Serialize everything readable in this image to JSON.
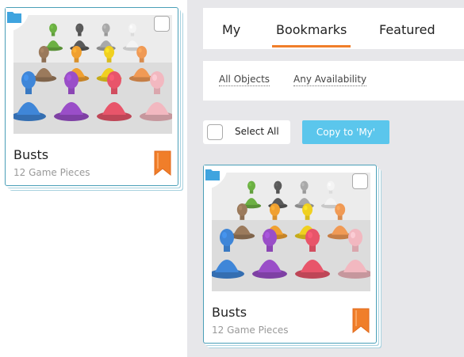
{
  "tabs": [
    {
      "label": "My",
      "active": false
    },
    {
      "label": "Bookmarks",
      "active": true
    },
    {
      "label": "Featured",
      "active": false
    }
  ],
  "filters": {
    "objects": "All Objects",
    "availability": "Any Availability"
  },
  "actions": {
    "select_all": "Select All",
    "copy": "Copy to 'My'"
  },
  "cards": [
    {
      "title": "Busts",
      "subtitle": "12 Game Pieces",
      "image": "busts-thumbnail",
      "bookmarked": true
    },
    {
      "title": "Busts",
      "subtitle": "12 Game Pieces",
      "image": "busts-thumbnail",
      "bookmarked": true
    }
  ],
  "colors": {
    "accent_orange": "#f07e2a",
    "copy_button": "#5bc6ec",
    "folder_blue": "#3fa4df",
    "card_border": "#4a9fb8"
  }
}
